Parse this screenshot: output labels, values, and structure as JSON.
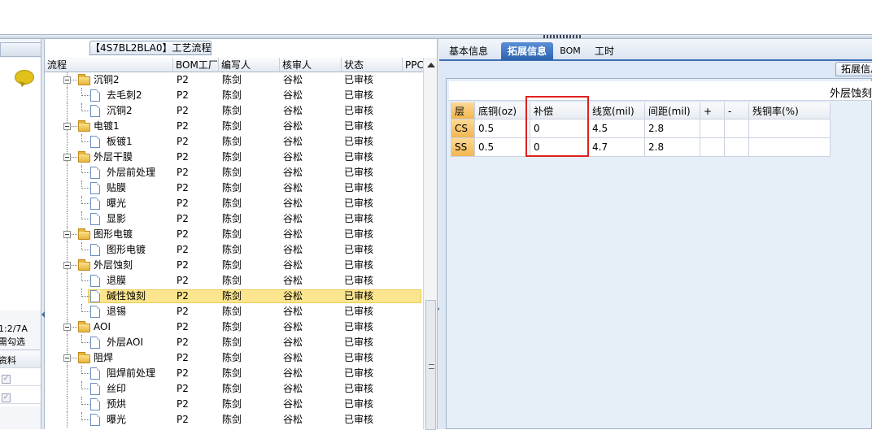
{
  "process_title": "【4S7BL2BLA0】工艺流程",
  "left_panel": {
    "text1": "1:2/7A",
    "text2": "需勾选",
    "text3": "资料",
    "check_rows": [
      "✓",
      "✓"
    ]
  },
  "tree_columns": [
    "流程",
    "BOM工厂",
    "编写人",
    "核审人",
    "状态",
    "PPC"
  ],
  "tree_rows": [
    {
      "level": 0,
      "type": "folder",
      "name": "沉铜2",
      "factory": "P2",
      "writer": "陈剑",
      "reviewer": "谷松",
      "status": "已审核"
    },
    {
      "level": 1,
      "type": "doc",
      "name": "去毛刺2",
      "factory": "P2",
      "writer": "陈剑",
      "reviewer": "谷松",
      "status": "已审核"
    },
    {
      "level": 1,
      "type": "doc",
      "name": "沉铜2",
      "factory": "P2",
      "writer": "陈剑",
      "reviewer": "谷松",
      "status": "已审核"
    },
    {
      "level": 0,
      "type": "folder",
      "name": "电镀1",
      "factory": "P2",
      "writer": "陈剑",
      "reviewer": "谷松",
      "status": "已审核"
    },
    {
      "level": 1,
      "type": "doc",
      "name": "板镀1",
      "factory": "P2",
      "writer": "陈剑",
      "reviewer": "谷松",
      "status": "已审核"
    },
    {
      "level": 0,
      "type": "folder",
      "name": "外层干膜",
      "factory": "P2",
      "writer": "陈剑",
      "reviewer": "谷松",
      "status": "已审核"
    },
    {
      "level": 1,
      "type": "doc",
      "name": "外层前处理",
      "factory": "P2",
      "writer": "陈剑",
      "reviewer": "谷松",
      "status": "已审核"
    },
    {
      "level": 1,
      "type": "doc",
      "name": "贴膜",
      "factory": "P2",
      "writer": "陈剑",
      "reviewer": "谷松",
      "status": "已审核"
    },
    {
      "level": 1,
      "type": "doc",
      "name": "曝光",
      "factory": "P2",
      "writer": "陈剑",
      "reviewer": "谷松",
      "status": "已审核"
    },
    {
      "level": 1,
      "type": "doc",
      "name": "显影",
      "factory": "P2",
      "writer": "陈剑",
      "reviewer": "谷松",
      "status": "已审核"
    },
    {
      "level": 0,
      "type": "folder",
      "name": "图形电镀",
      "factory": "P2",
      "writer": "陈剑",
      "reviewer": "谷松",
      "status": "已审核"
    },
    {
      "level": 1,
      "type": "doc",
      "name": "图形电镀",
      "factory": "P2",
      "writer": "陈剑",
      "reviewer": "谷松",
      "status": "已审核"
    },
    {
      "level": 0,
      "type": "folder",
      "name": "外层蚀刻",
      "factory": "P2",
      "writer": "陈剑",
      "reviewer": "谷松",
      "status": "已审核"
    },
    {
      "level": 1,
      "type": "doc",
      "name": "退膜",
      "factory": "P2",
      "writer": "陈剑",
      "reviewer": "谷松",
      "status": "已审核"
    },
    {
      "level": 1,
      "type": "doc",
      "name": "碱性蚀刻",
      "factory": "P2",
      "writer": "陈剑",
      "reviewer": "谷松",
      "status": "已审核",
      "selected": true
    },
    {
      "level": 1,
      "type": "doc",
      "name": "退锡",
      "factory": "P2",
      "writer": "陈剑",
      "reviewer": "谷松",
      "status": "已审核"
    },
    {
      "level": 0,
      "type": "folder",
      "name": "AOI",
      "factory": "P2",
      "writer": "陈剑",
      "reviewer": "谷松",
      "status": "已审核"
    },
    {
      "level": 1,
      "type": "doc",
      "name": "外层AOI",
      "factory": "P2",
      "writer": "陈剑",
      "reviewer": "谷松",
      "status": "已审核"
    },
    {
      "level": 0,
      "type": "folder",
      "name": "阻焊",
      "factory": "P2",
      "writer": "陈剑",
      "reviewer": "谷松",
      "status": "已审核"
    },
    {
      "level": 1,
      "type": "doc",
      "name": "阻焊前处理",
      "factory": "P2",
      "writer": "陈剑",
      "reviewer": "谷松",
      "status": "已审核"
    },
    {
      "level": 1,
      "type": "doc",
      "name": "丝印",
      "factory": "P2",
      "writer": "陈剑",
      "reviewer": "谷松",
      "status": "已审核"
    },
    {
      "level": 1,
      "type": "doc",
      "name": "预烘",
      "factory": "P2",
      "writer": "陈剑",
      "reviewer": "谷松",
      "status": "已审核"
    },
    {
      "level": 1,
      "type": "doc",
      "name": "曝光",
      "factory": "P2",
      "writer": "陈剑",
      "reviewer": "谷松",
      "status": "已审核"
    }
  ],
  "tabs": [
    {
      "label": "基本信息",
      "active": false
    },
    {
      "label": "拓展信息",
      "active": true
    },
    {
      "label": "BOM",
      "active": false
    },
    {
      "label": "工时",
      "active": false
    }
  ],
  "subtab_label": "拓展信息",
  "section_title": "外层蚀刻",
  "ext_columns": [
    "层",
    "底铜(oz)",
    "补偿",
    "线宽(mil)",
    "间距(mil)",
    "+",
    "-",
    "残铜率(%)"
  ],
  "ext_rows": [
    [
      "CS",
      "0.5",
      "0",
      "4.5",
      "2.8",
      "",
      "",
      ""
    ],
    [
      "SS",
      "0.5",
      "0",
      "4.7",
      "2.8",
      "",
      "",
      ""
    ]
  ],
  "colors": {
    "selected_row": "#fbe58e",
    "tab_active": "#2c62ad",
    "highlight_box": "#e02020",
    "layer_cell": "#f2b64f"
  }
}
